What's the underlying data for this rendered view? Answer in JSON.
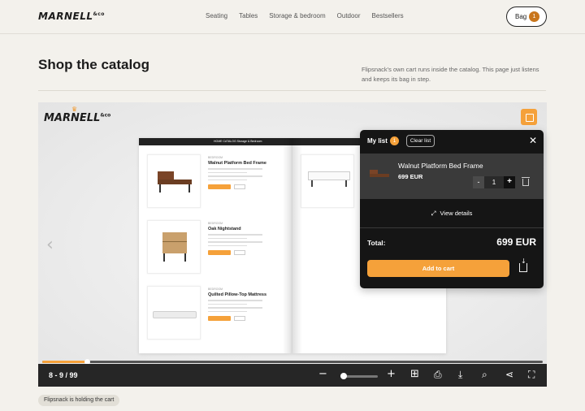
{
  "brand": {
    "name": "MARNELL",
    "suffix": "&co"
  },
  "nav": {
    "items": [
      "Seating",
      "Tables",
      "Storage & bedroom",
      "Outdoor",
      "Bestsellers"
    ]
  },
  "bag": {
    "label": "Bag",
    "count": "1"
  },
  "page": {
    "title": "Shop the catalog",
    "description": "Flipsnack's own cart runs inside the catalog. This page just listens and keeps its bag in step."
  },
  "viewer": {
    "page_header": "HOME CATALOG   Storage & Bedroom",
    "products": [
      {
        "category": "BEDROOM",
        "name": "Walnut Platform Bed Frame"
      },
      {
        "category": "BEDROOM",
        "name": "Oak Nightstand"
      },
      {
        "category": "BEDROOM",
        "name": "Quilted Pillow-Top Mattress"
      }
    ],
    "page_indicator": "8 - 9 / 99",
    "progress": 0.09
  },
  "cart": {
    "title": "My list",
    "count": "1",
    "clear_label": "Clear list",
    "item": {
      "name": "Walnut Platform Bed Frame",
      "price": "699 EUR",
      "qty": "1"
    },
    "view_details": "View details",
    "total_label": "Total:",
    "total_value": "699 EUR",
    "add_label": "Add to cart"
  },
  "status": "Flipsnack is holding the cart",
  "colors": {
    "accent": "#f5a13a",
    "panel": "#151515",
    "toolbar": "#262626"
  }
}
